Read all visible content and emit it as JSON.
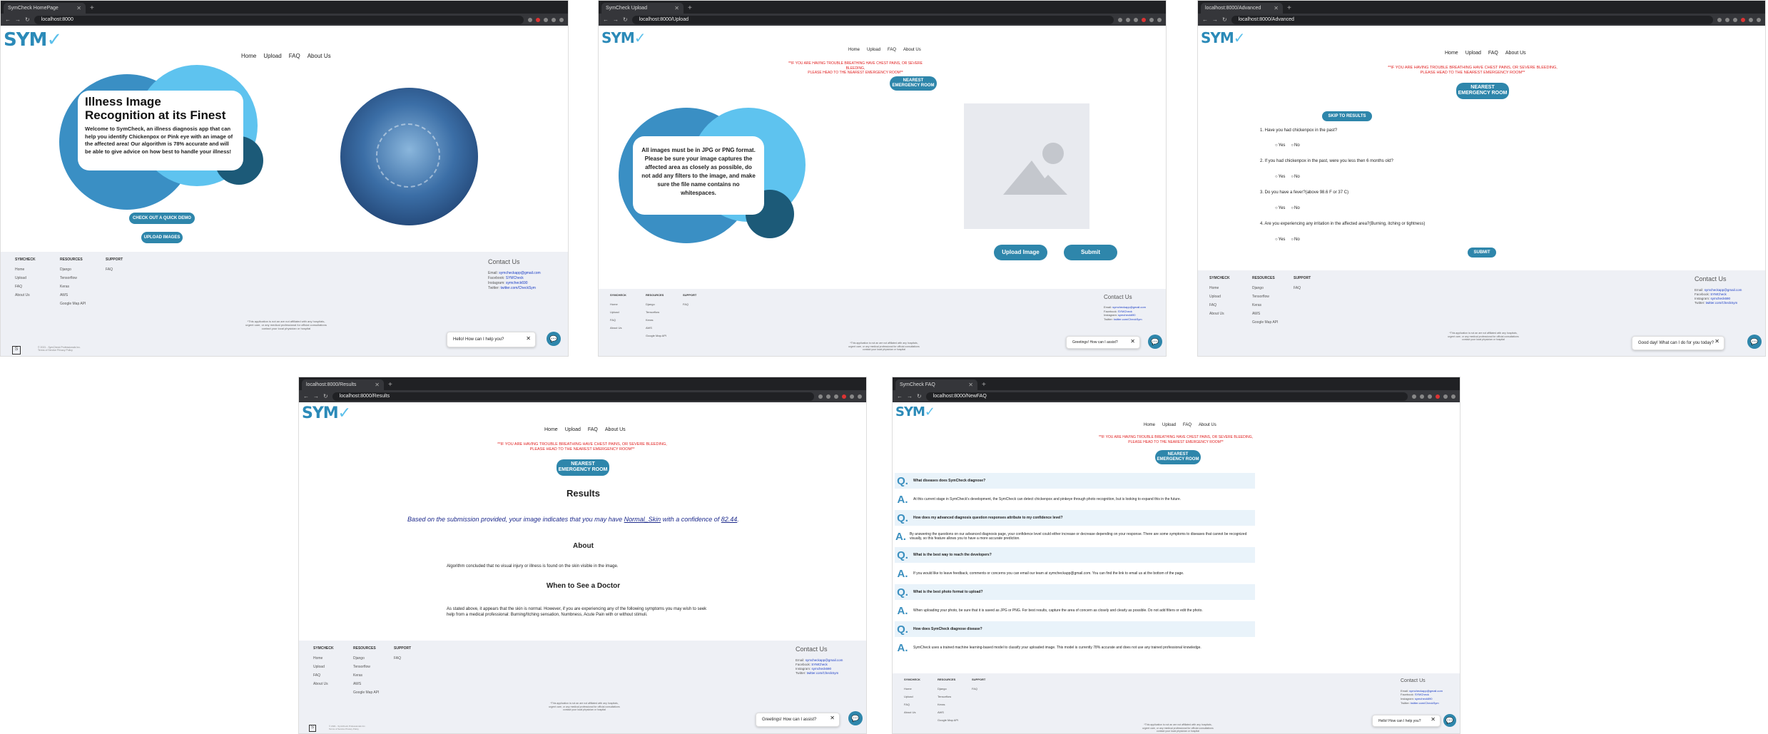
{
  "common": {
    "logo_text": "SYM",
    "logo_check": "✓",
    "nav": [
      "Home",
      "Upload",
      "FAQ",
      "About Us"
    ],
    "warning_line1": "**IF YOU ARE HAVING TROUBLE BREATHING HAVE CHEST PAINS, OR SEVERE BLEEDING,",
    "warning_line2": "PLEASE HEAD TO THE NEAREST EMERGENCY ROOM**",
    "er_button_line1": "NEAREST",
    "er_button_line2": "EMERGENCY ROOM",
    "footer": {
      "col1_title": "SYMCHECK",
      "col1": [
        "Home",
        "Upload",
        "FAQ",
        "About Us"
      ],
      "col2_title": "RESOURCES",
      "col2": [
        "Django",
        "Tensorflow",
        "Keras",
        "AWS",
        "Google Map API"
      ],
      "col3_title": "SUPPORT",
      "col3": [
        "FAQ"
      ],
      "contact_title": "Contact Us",
      "email_label": "Email:",
      "email": "symcheckapp@gmail.com",
      "facebook_label": "Facebook:",
      "facebook": "SYMCheck",
      "instagram_label": "Instagram:",
      "instagram": "symcheck690",
      "twitter_label": "Twitter:",
      "twitter": "twitter.com/CheckSym",
      "disclaimer1": "*This application is not an are not affiliated with any hospitals,",
      "disclaimer2": "urgent care, or any medical professional for official consultations",
      "disclaimer3": "contact your local physician or hospital",
      "copyright1": "© 2021 - SymCheck Professionals Inc.",
      "copyright2": "Terms of Service  Privacy Policy"
    },
    "chat_close": "✕",
    "chat_icon": "💬"
  },
  "windows": [
    {
      "tab": "SymCheck HomePage",
      "url": "localhost:8000"
    },
    {
      "tab": "SymCheck Upload",
      "url": "localhost:8000/Upload"
    },
    {
      "tab": "localhost:8000/Advanced",
      "url": "localhost:8000/Advanced"
    },
    {
      "tab": "localhost:8000/Results",
      "url": "localhost:8000/Results"
    },
    {
      "tab": "SymCheck FAQ",
      "url": "localhost:8000/NewFAQ"
    }
  ],
  "home": {
    "title_line1": "Illness Image",
    "title_line2": "Recognition at its Finest",
    "body": "Welcome to SymCheck, an illness diagnosis app that can help you identify Chickenpox or Pink eye with an image of the affected area! Our algorithm is 78% accurate and will be able to give advice on how best to handle your illness!",
    "demo_button": "CHECK OUT A QUICK DEMO",
    "upload_button": "UPLOAD IMAGES",
    "chat": "Hello! How can I help you?"
  },
  "upload": {
    "card_text": "All images must be in JPG or PNG format. Please be sure your image captures the affected area as closely as possible, do not add any filters to the image, and make sure the file name contains no whitespaces.",
    "upload_button": "Upload Image",
    "submit_button": "Submit",
    "chat": "Greetings! How can I assist?"
  },
  "advanced": {
    "skip_button": "SKIP TO RESULTS",
    "questions": [
      "1. Have you had chickenpox in the past?",
      "2. If you had chickenpox in the past, were you less then 6 months old?",
      "3. Do you have a fever?(above 98.6 F or 37 C)",
      "4. Are you experiencing any irritation in the affected area?(Burning, itching or tightness)"
    ],
    "yes": "Yes",
    "no": "No",
    "submit_button": "SUBMIT",
    "chat": "Good day! What can I do for you today?"
  },
  "results": {
    "heading": "Results",
    "statement_pre": "Based on the submission provided, your image indicates that you may have ",
    "condition": "Normal_Skin",
    "statement_mid": " with a confidence of ",
    "confidence": "82.44",
    "statement_end": ".",
    "about_heading": "About",
    "about_text": "Algorithm concluded that no visual injury or illness is found on the skin visible in the image.",
    "doctor_heading": "When to See a Doctor",
    "doctor_text": "As stated above, it appears that the skin is normal. However, if you are experiencing any of the following symptoms you may wish to seek help from a medical professional: Burning/Itching sensation, Numbness, Acute Pain with or without stimuli.",
    "chat": "Greetings! How can I assist?"
  },
  "faq": {
    "items": [
      {
        "q": "What diseases does SymCheck diagnose?",
        "a": "At this current stage in SymCheck's development, the SymCheck can detect chickenpox and pinkeye through photo recognition, but is looking to expand this in the future."
      },
      {
        "q": "How does my advanced diagnosis question responses attribute to my confidence level?",
        "a": "By answering the questions on our advanced diagnosis page, your confidence level could either increase or decrease depending on your response. There are some symptoms to diseases that cannot be recognized visually, so this feature allows you to have a more accurate prediction."
      },
      {
        "q": "What is the best way to reach the developers?",
        "a": "If you would like to leave feedback, comments or concerns you can email our team at symcheckapp@gmail.com. You can find the link to email us at the bottom of the page."
      },
      {
        "q": "What is the best photo format to upload?",
        "a": "When uploading your photo, be sure that it is saved as JPG or PNG. For best results, capture the area of concern as closely and clearly as possible. Do not add filters or edit the photo."
      },
      {
        "q": "How does SymCheck diagnose disease?",
        "a": "SymCheck uses a trained machine learning-based model to classify your uploaded image. This model is currently 78% accurate and does not use any trained professional knowledge."
      }
    ],
    "q_letter": "Q.",
    "a_letter": "A.",
    "chat": "Hello! How can I help you?"
  }
}
